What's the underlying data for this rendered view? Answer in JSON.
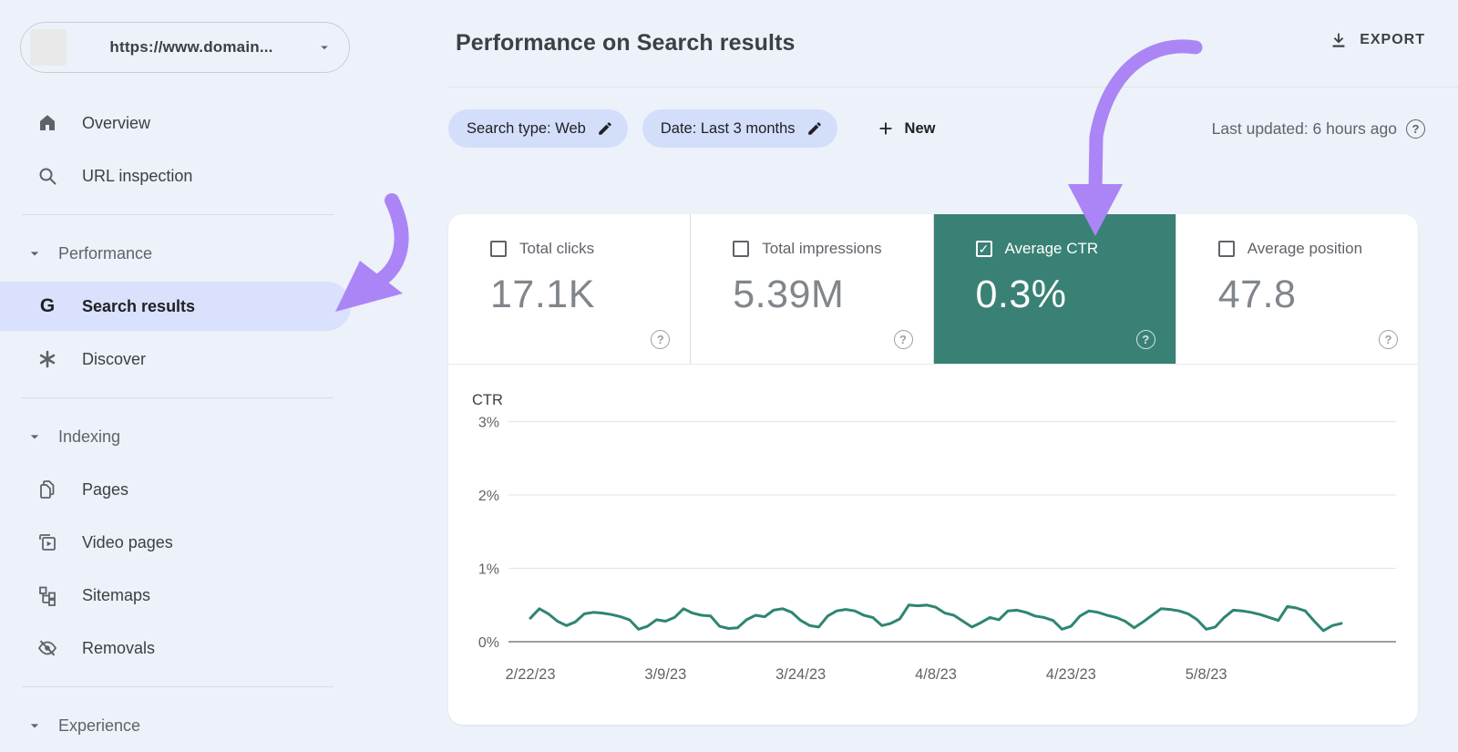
{
  "colors": {
    "background": "#edf1f9",
    "card": "#ffffff",
    "accent_teal": "#398174",
    "chip_background": "#d3defb",
    "selected_pill": "#d9e1fc",
    "arrow_purple": "#ab85f6",
    "line_color": "#2e8573",
    "text_primary": "#202124",
    "text_secondary": "#5f6368"
  },
  "sidebar": {
    "property_selector": {
      "url_label": "https://www.domain...",
      "favicon": "placeholder-favicon",
      "caret": "chevron-down-icon"
    },
    "items": [
      {
        "type": "item",
        "icon": "home-icon",
        "label": "Overview",
        "selected": false
      },
      {
        "type": "item",
        "icon": "search-icon",
        "label": "URL inspection",
        "selected": false
      },
      {
        "type": "divider"
      },
      {
        "type": "section",
        "icon": "caret-down-icon",
        "label": "Performance"
      },
      {
        "type": "item",
        "icon": "google-g-icon",
        "label": "Search results",
        "selected": true
      },
      {
        "type": "item",
        "icon": "discover-icon",
        "label": "Discover",
        "selected": false
      },
      {
        "type": "divider"
      },
      {
        "type": "section",
        "icon": "caret-down-icon",
        "label": "Indexing"
      },
      {
        "type": "item",
        "icon": "pages-icon",
        "label": "Pages",
        "selected": false
      },
      {
        "type": "item",
        "icon": "video-pages-icon",
        "label": "Video pages",
        "selected": false
      },
      {
        "type": "item",
        "icon": "sitemaps-icon",
        "label": "Sitemaps",
        "selected": false
      },
      {
        "type": "item",
        "icon": "removals-icon",
        "label": "Removals",
        "selected": false
      },
      {
        "type": "divider"
      },
      {
        "type": "section",
        "icon": "caret-down-icon",
        "label": "Experience"
      }
    ]
  },
  "header": {
    "title": "Performance on Search results",
    "export_label": "EXPORT",
    "export_icon": "download-icon"
  },
  "filters": {
    "chips": [
      {
        "label": "Search type: Web",
        "icon": "pencil-icon"
      },
      {
        "label": "Date: Last 3 months",
        "icon": "pencil-icon"
      }
    ],
    "new_button_label": "New",
    "new_button_icon": "plus-icon",
    "last_updated": "Last updated: 6 hours ago",
    "last_updated_icon": "help-icon"
  },
  "metrics": {
    "cards": [
      {
        "label": "Total clicks",
        "value": "17.1K",
        "checked": false,
        "selected": false
      },
      {
        "label": "Total impressions",
        "value": "5.39M",
        "checked": false,
        "selected": false
      },
      {
        "label": "Average CTR",
        "value": "0.3%",
        "checked": true,
        "selected": true
      },
      {
        "label": "Average position",
        "value": "47.8",
        "checked": false,
        "selected": false
      }
    ]
  },
  "chart_data": {
    "type": "line",
    "title": "",
    "ylabel": "CTR",
    "xlabel": "",
    "ylim": [
      0,
      3
    ],
    "grid": true,
    "legend_position": "none",
    "y_ticks": [
      {
        "label": "3%",
        "value": 3
      },
      {
        "label": "2%",
        "value": 2
      },
      {
        "label": "1%",
        "value": 1
      },
      {
        "label": "0%",
        "value": 0
      }
    ],
    "x_ticks": [
      {
        "label": "2/22/23",
        "day": 0
      },
      {
        "label": "3/9/23",
        "day": 15
      },
      {
        "label": "3/24/23",
        "day": 30
      },
      {
        "label": "4/8/23",
        "day": 45
      },
      {
        "label": "4/23/23",
        "day": 60
      },
      {
        "label": "5/8/23",
        "day": 75
      }
    ],
    "series": [
      {
        "name": "CTR",
        "unit": "%",
        "color": "#2e8573",
        "values": [
          0.32,
          0.45,
          0.38,
          0.28,
          0.22,
          0.27,
          0.38,
          0.4,
          0.39,
          0.37,
          0.34,
          0.3,
          0.17,
          0.21,
          0.3,
          0.28,
          0.33,
          0.45,
          0.39,
          0.36,
          0.35,
          0.21,
          0.18,
          0.19,
          0.3,
          0.36,
          0.34,
          0.43,
          0.45,
          0.4,
          0.29,
          0.22,
          0.2,
          0.35,
          0.42,
          0.44,
          0.42,
          0.36,
          0.33,
          0.22,
          0.25,
          0.31,
          0.5,
          0.49,
          0.5,
          0.47,
          0.39,
          0.36,
          0.28,
          0.2,
          0.26,
          0.33,
          0.3,
          0.42,
          0.43,
          0.4,
          0.35,
          0.33,
          0.29,
          0.17,
          0.21,
          0.35,
          0.42,
          0.4,
          0.36,
          0.33,
          0.28,
          0.19,
          0.27,
          0.36,
          0.45,
          0.44,
          0.42,
          0.38,
          0.3,
          0.17,
          0.2,
          0.33,
          0.43,
          0.42,
          0.4,
          0.37,
          0.33,
          0.29,
          0.48,
          0.46,
          0.42,
          0.28,
          0.15,
          0.22,
          0.25
        ]
      }
    ]
  },
  "annotations": {
    "arrows": [
      {
        "name": "arrow-to-search-results",
        "points_at": "sidebar-item-search-results"
      },
      {
        "name": "arrow-to-average-ctr",
        "points_at": "metric-card-average-ctr"
      }
    ]
  }
}
